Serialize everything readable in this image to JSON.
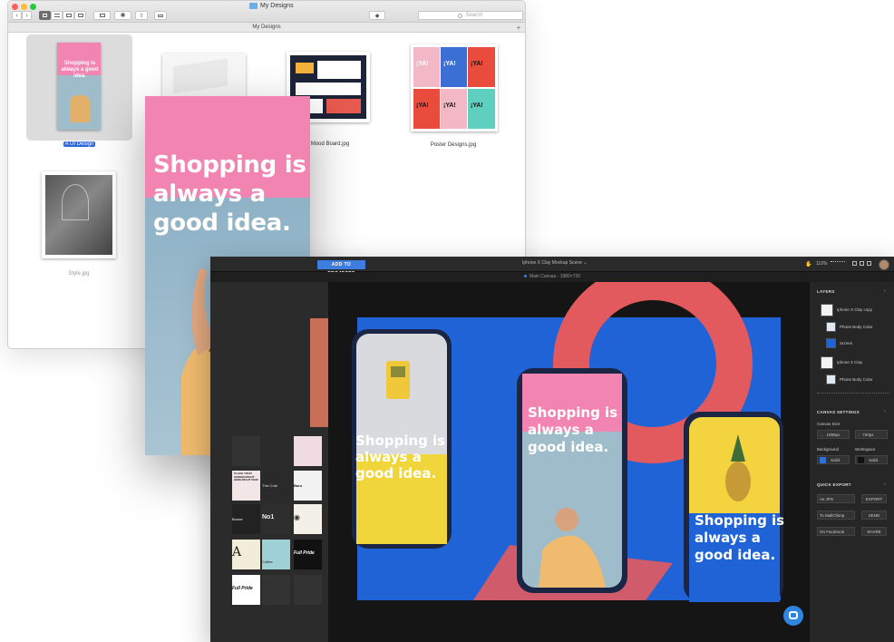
{
  "finder": {
    "title": "My Designs",
    "path_label": "My Designs",
    "search_placeholder": "Search",
    "plus": "+",
    "files": [
      {
        "name": "A UI Design",
        "selected": true
      },
      {
        "name": "",
        "selected": false
      },
      {
        "name": "Mood Board.jpg",
        "selected": false
      },
      {
        "name": "Poster Designs.jpg",
        "selected": false
      },
      {
        "name": "Style.jpg",
        "selected": false
      }
    ],
    "nav": {
      "back": "‹",
      "forward": "›"
    },
    "thumb_text": {
      "headline": "Shopping is always a good idea.",
      "ya": "¡YA!"
    }
  },
  "poster": {
    "headline_lines": [
      "Shopping is",
      "always a",
      "good idea."
    ]
  },
  "editor": {
    "add_button": "ADD TO PROJECTS",
    "document_title": "Iphone X Clay Mockup Scene  ⌄",
    "canvas_label": "Main Canvas - 1980×720",
    "zoom": "110%",
    "canvas": {
      "phone_left_text": [
        "Shopping is",
        "always a",
        "good idea."
      ],
      "phone_center_text": [
        "Shopping is",
        "always a",
        "good idea."
      ],
      "phone_right_text": [
        "Shopping is",
        "always a",
        "good idea."
      ],
      "colors": {
        "bg": "#1f63d6",
        "ring": "#e35a5e",
        "phone": "#1b2644"
      }
    },
    "left_tiles": [
      "PLACE YOUR SCREEN RIGHT HERE RIGHT NOW",
      "This Cute",
      "Baru",
      "Boone",
      "No1",
      "Coffee",
      "Full Pride",
      "Full Pride",
      "Baru"
    ],
    "right_panel": {
      "layers_header": "LAYERS",
      "layers": [
        {
          "label": "Iphone X Clay copy",
          "indent": false
        },
        {
          "label": "Phone Body Color",
          "indent": true
        },
        {
          "label": "Screen",
          "indent": true
        },
        {
          "label": "Iphone X Clay",
          "indent": false
        },
        {
          "label": "Phone Body Color",
          "indent": true
        }
      ],
      "canvas_settings_header": "CANVAS SETTINGS",
      "canvas_size_label": "Canvas Size",
      "width_value": "1080px",
      "height_value": "720px",
      "background_label": "Background",
      "workspace_label": "Workspace",
      "background_value": "Solid",
      "workspace_value": "Solid",
      "quick_export_header": "QUICK EXPORT",
      "exports": [
        {
          "target": "As JPG",
          "action": "EXPORT"
        },
        {
          "target": "To MailChimp",
          "action": "SEND"
        },
        {
          "target": "On Facebook",
          "action": "SHARE"
        }
      ],
      "width_icon": "↔",
      "height_icon": "↕"
    }
  }
}
